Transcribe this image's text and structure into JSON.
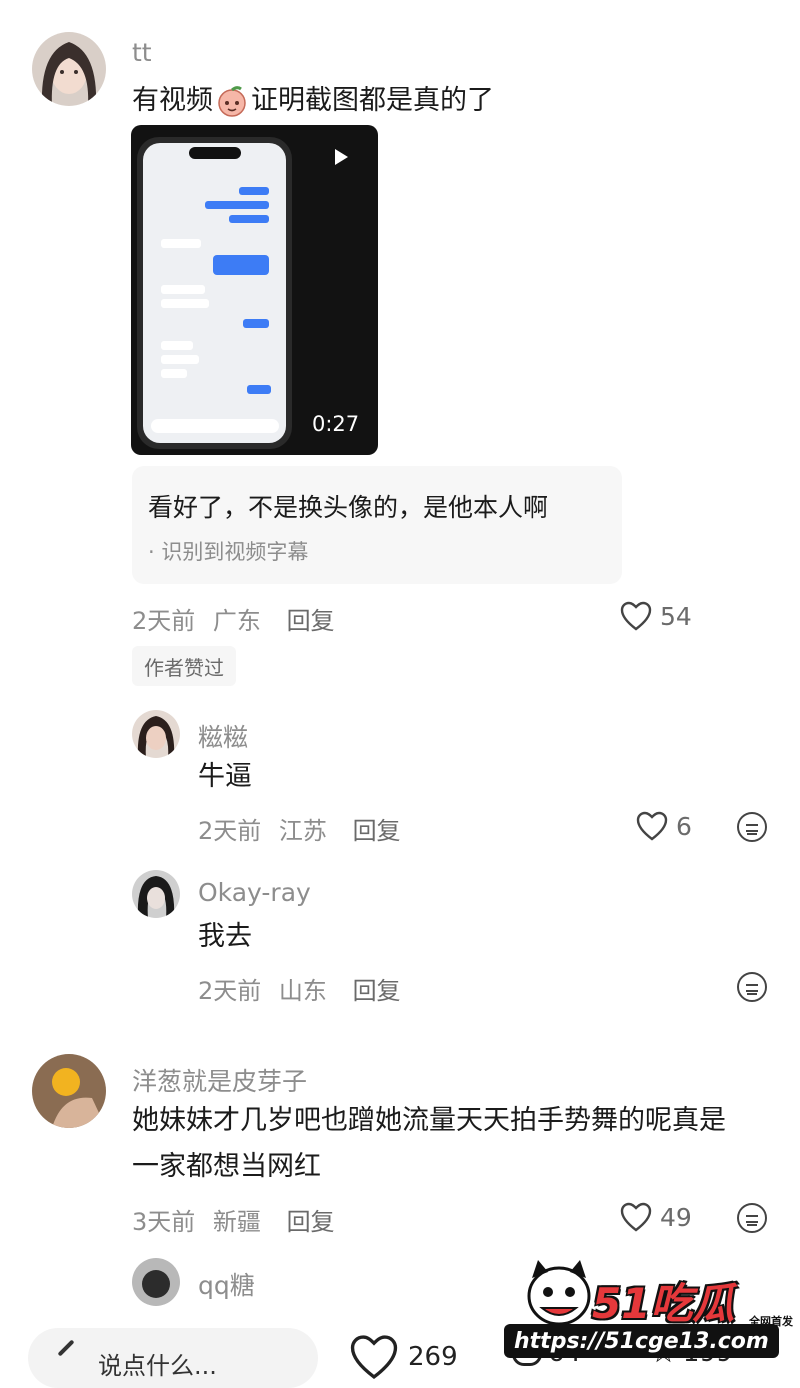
{
  "comments": [
    {
      "username": "tt",
      "text_before": "有视频",
      "text_after": "证明截图都是真的了",
      "video": {
        "duration": "0:27"
      },
      "subtitle_box": {
        "text": "看好了，不是换头像的，是他本人啊",
        "note": "· 识别到视频字幕"
      },
      "time": "2天前",
      "location": "广东",
      "reply_label": "回复",
      "likes": "54",
      "author_liked": "作者赞过"
    },
    {
      "username": "糍糍",
      "text": "牛逼",
      "time": "2天前",
      "location": "江苏",
      "reply_label": "回复",
      "likes": "6"
    },
    {
      "username": "Okay-ray",
      "text": "我去",
      "time": "2天前",
      "location": "山东",
      "reply_label": "回复"
    },
    {
      "username": "洋葱就是皮芽子",
      "text_line1": "她妹妹才几岁吧也蹭她流量天天拍手势舞的呢真是",
      "text_line2": "一家都想当网红",
      "time": "3天前",
      "location": "新疆",
      "reply_label": "回复",
      "likes": "49"
    },
    {
      "username": "qq糖"
    }
  ],
  "bottom_bar": {
    "input_placeholder": "说点什么...",
    "likes": "269",
    "comments": "64",
    "stars": "199"
  },
  "watermark": {
    "brand": "51吃瓜",
    "tag": "全网首发",
    "url": "https://51cge13.com"
  },
  "colors": {
    "meta_gray": "#8d8d8d",
    "phone_bubble_blue": "#3d7cf5",
    "watermark_red": "#e5383b"
  }
}
